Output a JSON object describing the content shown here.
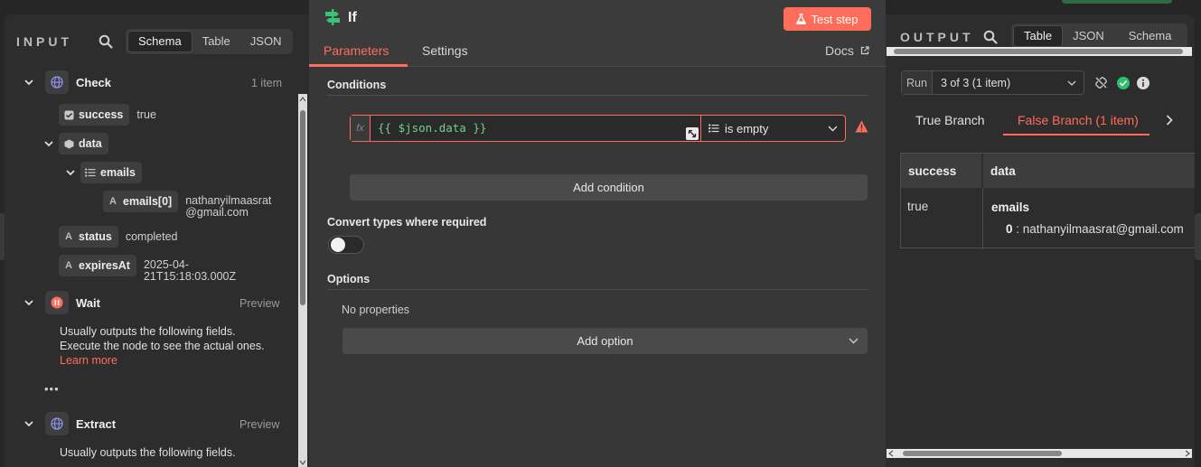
{
  "input": {
    "title": "INPUT",
    "tabs": [
      "Schema",
      "Table",
      "JSON"
    ],
    "active_tab": "Schema",
    "nodes": {
      "check": {
        "name": "Check",
        "meta": "1 item",
        "fields": {
          "success_key": "success",
          "success_val": "true",
          "data_key": "data",
          "emails_key": "emails",
          "emails0_key": "emails[0]",
          "emails0_val_l1": "nathanyilmaasrat",
          "emails0_val_l2": "@gmail.com",
          "status_key": "status",
          "status_val": "completed",
          "expires_key": "expiresAt",
          "expires_val_l1": "2025-04-",
          "expires_val_l2": "21T15:18:03.000Z"
        }
      },
      "wait": {
        "name": "Wait",
        "meta": "Preview",
        "help_l1": "Usually outputs the following fields.",
        "help_l2": "Execute the node to see the actual ones.",
        "learn_more": "Learn more",
        "more": "•••"
      },
      "extract": {
        "name": "Extract",
        "meta": "Preview",
        "help_l1": "Usually outputs the following fields."
      }
    }
  },
  "center": {
    "node_title": "If",
    "test_step": "Test step",
    "tabs": {
      "parameters": "Parameters",
      "settings": "Settings"
    },
    "docs": "Docs",
    "conditions_label": "Conditions",
    "fx": "fx",
    "expression": "{{ $json.data }}",
    "operator": "is empty",
    "add_condition": "Add condition",
    "convert_label": "Convert types where required",
    "options_label": "Options",
    "no_properties": "No properties",
    "add_option": "Add option"
  },
  "output": {
    "title": "OUTPUT",
    "tabs": [
      "Table",
      "JSON",
      "Schema"
    ],
    "active_tab": "Table",
    "run_label": "Run",
    "run_value": "3 of 3 (1 item)",
    "branches": {
      "true": "True Branch",
      "false": "False Branch (1 item)"
    },
    "table": {
      "headers": [
        "success",
        "data"
      ],
      "success_val": "true",
      "data_key": "emails",
      "data_index": "0",
      "data_sep": " : ",
      "data_val": "nathanyilmaasrat@gmail.com"
    }
  },
  "colors": {
    "accent": "#ff6d5a",
    "success": "#2fbf71",
    "expression": "#6fd18d"
  }
}
